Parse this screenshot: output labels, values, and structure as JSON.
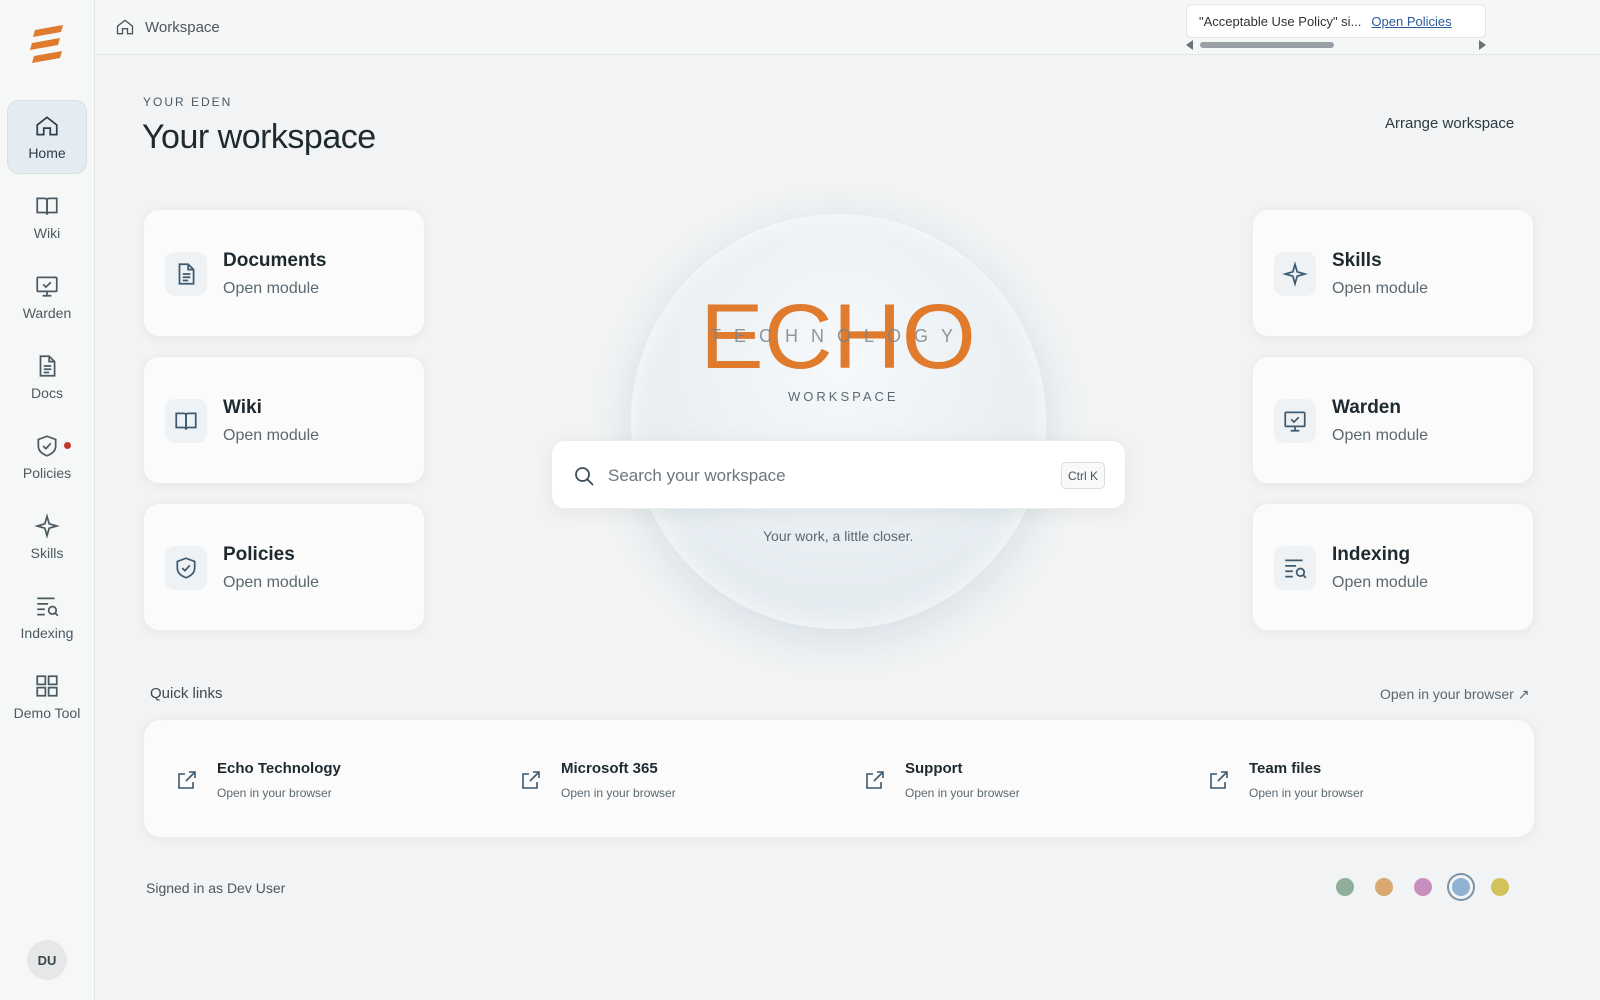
{
  "topbar": {
    "breadcrumb": "Workspace",
    "notice_text": "\"Acceptable Use Policy\" si...",
    "notice_link": "Open Policies"
  },
  "sidebar": {
    "items": [
      {
        "label": "Home",
        "icon": "home-icon"
      },
      {
        "label": "Wiki",
        "icon": "book-icon"
      },
      {
        "label": "Warden",
        "icon": "monitor-check-icon"
      },
      {
        "label": "Docs",
        "icon": "document-icon"
      },
      {
        "label": "Policies",
        "icon": "shield-check-icon"
      },
      {
        "label": "Skills",
        "icon": "sparkle-icon"
      },
      {
        "label": "Indexing",
        "icon": "list-search-icon"
      },
      {
        "label": "Demo Tool",
        "icon": "grid-icon"
      }
    ],
    "avatar": "DU"
  },
  "header": {
    "eyebrow": "YOUR EDEN",
    "title": "Your workspace",
    "arrange": "Arrange workspace"
  },
  "modules": {
    "left": [
      {
        "name": "Documents",
        "sub": "Open module",
        "icon": "document-icon"
      },
      {
        "name": "Wiki",
        "sub": "Open module",
        "icon": "book-icon"
      },
      {
        "name": "Policies",
        "sub": "Open module",
        "icon": "shield-check-icon"
      }
    ],
    "right": [
      {
        "name": "Skills",
        "sub": "Open module",
        "icon": "sparkle-icon"
      },
      {
        "name": "Warden",
        "sub": "Open module",
        "icon": "monitor-check-icon"
      },
      {
        "name": "Indexing",
        "sub": "Open module",
        "icon": "list-search-icon"
      }
    ]
  },
  "center": {
    "logo_text": "ECHO",
    "logo_sub": "TECHNOLOGY",
    "workspace_label": "WORKSPACE",
    "search_placeholder": "Search your workspace",
    "shortcut": "Ctrl K",
    "tagline": "Your work, a little closer."
  },
  "quick_links": {
    "title": "Quick links",
    "browser_link": "Open in your browser ↗",
    "items": [
      {
        "name": "Echo Technology",
        "sub": "Open in your browser"
      },
      {
        "name": "Microsoft 365",
        "sub": "Open in your browser"
      },
      {
        "name": "Support",
        "sub": "Open in your browser"
      },
      {
        "name": "Team files",
        "sub": "Open in your browser"
      }
    ]
  },
  "footer": {
    "signed_in": "Signed in as Dev User",
    "theme_colors": [
      "#8fae9a",
      "#d9a873",
      "#c98fbf",
      "#8fb2d4",
      "#d1c25a"
    ],
    "selected_theme": 3
  },
  "colors": {
    "accent": "#e07a2c",
    "notice_dot": "#c0392b"
  }
}
